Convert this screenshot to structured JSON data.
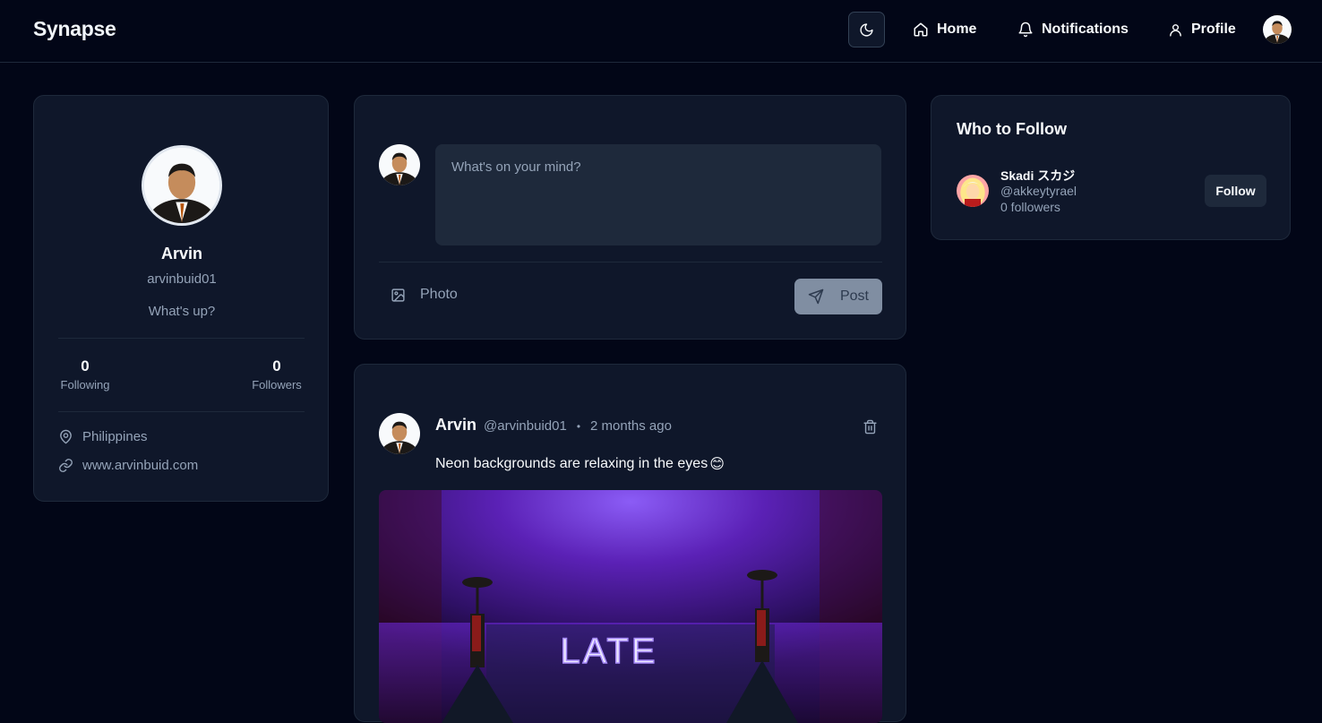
{
  "nav": {
    "brand": "Synapse",
    "home_label": "Home",
    "notifications_label": "Notifications",
    "profile_label": "Profile"
  },
  "profile": {
    "name": "Arvin",
    "handle": "arvinbuid01",
    "bio": "What's up?",
    "following_count": "0",
    "following_label": "Following",
    "followers_count": "0",
    "followers_label": "Followers",
    "location": "Philippines",
    "website": "www.arvinbuid.com"
  },
  "composer": {
    "placeholder": "What's on your mind?",
    "photo_label": "Photo",
    "post_label": "Post"
  },
  "post": {
    "author": "Arvin",
    "handle": "@arvinbuid01",
    "separator": "•",
    "time": "2 months ago",
    "text": "Neon backgrounds are relaxing in the eyes",
    "emoji": "😊",
    "image_sign_text": "LATE"
  },
  "who_to_follow": {
    "title": "Who to Follow",
    "suggestions": [
      {
        "name": "Skadi スカジ",
        "handle": "@akkeytyrael",
        "followers": "0 followers",
        "follow_label": "Follow"
      }
    ]
  },
  "colors": {
    "background": "#020617",
    "card": "#0f172a",
    "border": "#1e293b",
    "muted_text": "#94a3b8",
    "neon_purple": "#7c3aed"
  }
}
